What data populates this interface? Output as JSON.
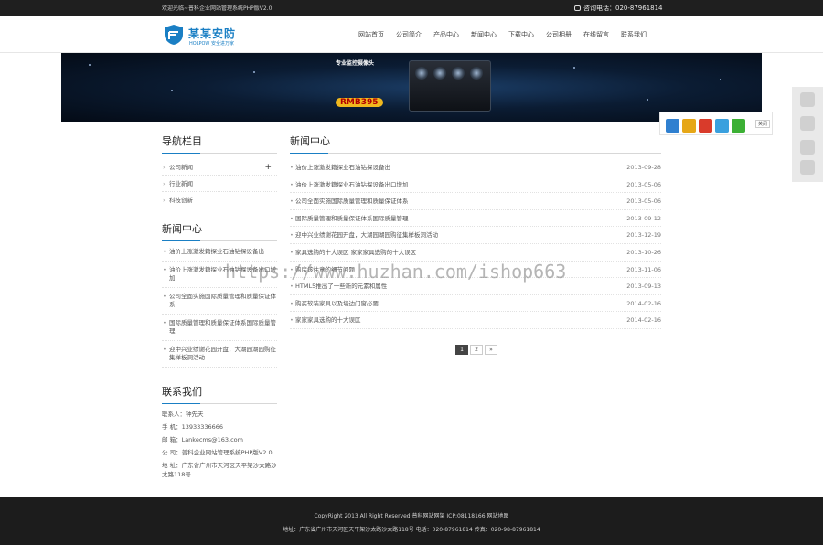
{
  "topbar": {
    "welcome": "欢迎光临~普科企业网站管理系统PHP版V2.0",
    "hotline_label": "咨询电话：",
    "hotline_number": "020-87961814"
  },
  "logo": {
    "brand": "某某安防",
    "sub": "HOLPOW  安全进万家"
  },
  "nav": {
    "items": [
      "网站首页",
      "公司简介",
      "产品中心",
      "新闻中心",
      "下载中心",
      "公司相册",
      "在线留言",
      "联系我们"
    ]
  },
  "banner": {
    "promo_line1": "专业监控摄像头",
    "promo_price": "RMB395"
  },
  "share": {
    "close_label": "关闭"
  },
  "sidebar": {
    "nav_title": "导航栏目",
    "categories": [
      "公司新闻",
      "行业新闻",
      "科技创新"
    ],
    "expand_symbol": "+",
    "news_title": "新闻中心",
    "news_items": [
      "油价上涨激发籍探业石油钻探设备出",
      "油价上涨激发籍探业石油钻探设备出口增加",
      "公司全面实施国际质量管理和质量保证体系",
      "国际质量管理和质量保证体系国际质量管理",
      "迎中兴业绩谢花园开盘，大湖园湖园购征集样板洞活动"
    ],
    "contact_title": "联系我们",
    "contact": [
      "联系人：钟先天",
      "手 机：13933336666",
      "邮 箱：Lankecms@163.com",
      "公 司：普科企业网站管理系统PHP版V2.0",
      "地 址：广东省广州市天河区天平架沙太路沙太路118号"
    ]
  },
  "main": {
    "title": "新闻中心",
    "news": [
      {
        "title": "油价上涨激发籍探业石油钻探设备出",
        "date": "2013-09-28"
      },
      {
        "title": "油价上涨激发籍探业石油钻探设备出口增加",
        "date": "2013-05-06"
      },
      {
        "title": "公司全面实施国际质量管理和质量保证体系",
        "date": "2013-05-06"
      },
      {
        "title": "国际质量管理和质量保证体系国际质量管理",
        "date": "2013-09-12"
      },
      {
        "title": "迎中兴业绩谢花园开盘，大湖园湖园购征集样板洞活动",
        "date": "2013-12-19"
      },
      {
        "title": "家具选购的十大误区 家家家具选购的十大误区",
        "date": "2013-10-26"
      },
      {
        "title": "购房该注意的细节问题",
        "date": "2013-11-06"
      },
      {
        "title": "HTML5推出了一些新的元素和属性",
        "date": "2013-09-13"
      },
      {
        "title": "购买软装家具以及墙边门窗必要",
        "date": "2014-02-16"
      },
      {
        "title": "家家家具选购的十大误区",
        "date": "2014-02-16"
      }
    ]
  },
  "pager": {
    "pages": [
      "1",
      "2",
      "»"
    ]
  },
  "watermark": "https://www.huzhan.com/ishop663",
  "footer": {
    "copyright": "CopyRight 2013 All Right Reserved 普科网站网架 ICP:08118166 网站地图",
    "address": "地址：广东省广州市天河区天平架沙太路沙太路118号  电话：020-87961814  传真：020-98-87961814"
  },
  "colors": {
    "accent": "#1a7fc4",
    "topbar": "#1f1f1f",
    "footer": "#1c1c1c"
  }
}
